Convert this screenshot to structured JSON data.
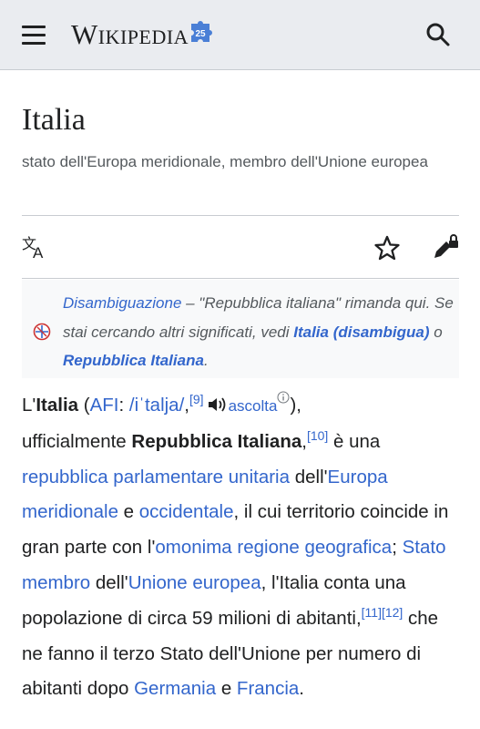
{
  "header": {
    "logo_text": "Wikipedia",
    "accent": "#3366cc",
    "icons": [
      "menu-icon",
      "puzzle-globe-icon",
      "search-icon"
    ]
  },
  "page": {
    "title": "Italia",
    "tagline": "stato dell'Europa meridionale, membro dell'Unione europea"
  },
  "toolbar": {
    "icons": [
      "language-icon",
      "star-icon",
      "edit-lock-icon"
    ]
  },
  "hatnote": {
    "lead": "Disambiguazione",
    "text1": " – \"Repubblica italiana\" rimanda qui. Se stai cercando altri significati, vedi ",
    "link1": "Italia (disambigua)",
    "text2": " o ",
    "link2": "Repubblica Italiana",
    "text3": "."
  },
  "article": {
    "p1": "L'",
    "title_bold": "Italia",
    "p2": " (",
    "afi": "AFI",
    "p3": ": ",
    "ipa": "/iˈtalja/",
    "p4": ",",
    "ref9": "[9]",
    "ascolta": "ascolta",
    "p5": "),",
    "p6": "ufficialmente ",
    "official_name": "Repubblica Italiana",
    "p7": ",",
    "ref10": "[10]",
    "p8": " è una ",
    "link_repubblica": "repubblica parlamentare unitaria",
    "p9": " dell'",
    "link_europa_mer": "Europa meridionale",
    "p10": " e ",
    "link_occidentale": "occidentale",
    "p11": ", il cui territorio coincide in gran parte con l'",
    "link_omonima": "omonima regione geografica",
    "p12": "; ",
    "link_stato_membro": "Stato membro",
    "p13": " dell'",
    "link_ue": "Unione europea",
    "p14": ", l'Italia conta una popolazione di circa 59 milioni di abitanti,",
    "ref11": "[11]",
    "ref12": "[12]",
    "p15": " che ne fanno il terzo Stato dell'Unione per numero di abitanti dopo ",
    "link_germania": "Germania",
    "p16": " e ",
    "link_francia": "Francia",
    "p17": "."
  }
}
